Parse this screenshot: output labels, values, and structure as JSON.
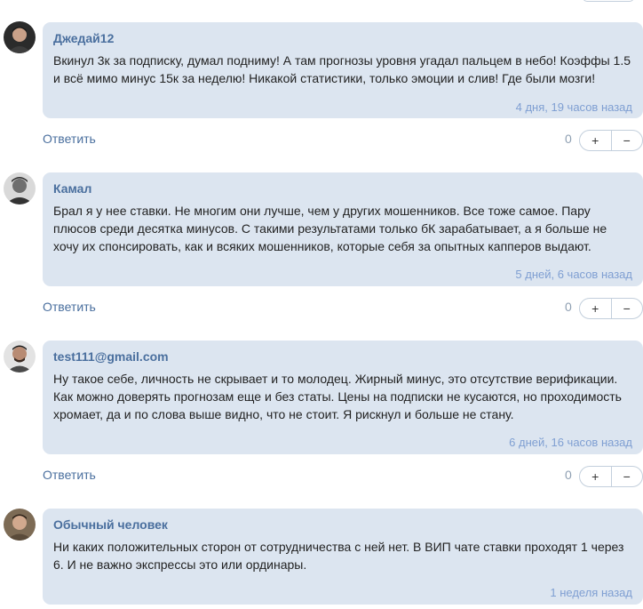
{
  "comments": [
    {
      "author": "Джедай12",
      "text": "Вкинул 3к за подписку, думал подниму! А там прогнозы уровня угадал пальцем в небо! Коэффы 1.5 и всё мимо минус 15к за неделю! Никакой статистики, только эмоции и слив! Где были мозги!",
      "time": "4 дня, 19 часов назад",
      "reply_label": "Ответить",
      "votes": "0",
      "plus": "+",
      "minus": "−",
      "avatar_icon": "user-avatar-photo"
    },
    {
      "author": "Камал",
      "text": "Брал я у нее ставки. Не многим они лучше, чем у других мошенников. Все тоже самое. Пару плюсов среди десятка минусов. С такими результатами только бК зарабатывает, а я больше не хочу их спонсировать, как и всяких мошенников, которые себя за опытных капперов выдают.",
      "time": "5 дней, 6 часов назад",
      "reply_label": "Ответить",
      "votes": "0",
      "plus": "+",
      "minus": "−",
      "avatar_icon": "user-avatar-photo"
    },
    {
      "author": "test111@gmail.com",
      "text": "Ну такое себе, личность не скрывает и то молодец. Жирный минус, это отсутствие верификации. Как можно доверять прогнозам еще и без статы. Цены на подписки не кусаются, но проходимость хромает, да и по слова выше видно, что не стоит. Я рискнул и больше не стану.",
      "time": "6 дней, 16 часов назад",
      "reply_label": "Ответить",
      "votes": "0",
      "plus": "+",
      "minus": "−",
      "avatar_icon": "user-avatar-photo"
    },
    {
      "author": "Обычный человек",
      "text": "Ни каких положительных сторон от сотрудничества с ней нет. В ВИП чате ставки проходят 1 через 6. И не важно экспрессы это или ординары.",
      "time": "1 неделя назад",
      "avatar_icon": "user-avatar-photo"
    }
  ]
}
